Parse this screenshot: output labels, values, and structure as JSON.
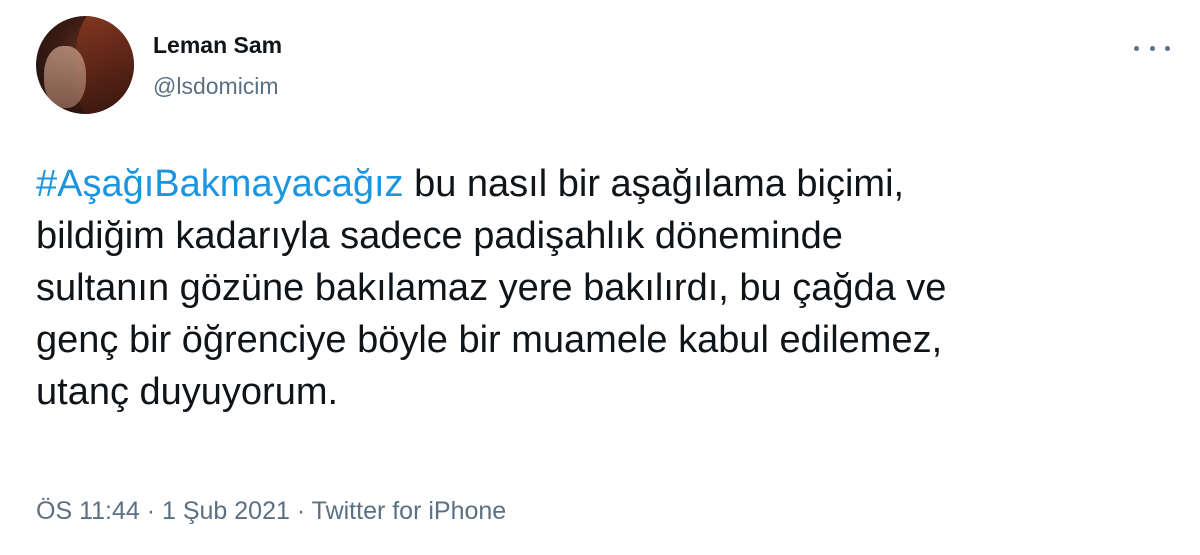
{
  "tweet": {
    "author_name": "Leman Sam",
    "author_handle": "@lsdomicim",
    "hashtag": "#AşağıBakmayacağız",
    "lines": [
      " bu nasıl bir aşağılama biçimi,",
      "bildiğim kadarıyla sadece padişahlık döneminde",
      "sultanın gözüne bakılamaz yere bakılırdı, bu çağda ve",
      "genç bir öğrenciye böyle bir muamele kabul edilemez,",
      "utanç duyuyorum."
    ],
    "time": "ÖS 11:44",
    "date": "1 Şub 2021",
    "source": "Twitter for iPhone",
    "separator": " · "
  },
  "icons": {
    "more": "more-options-icon",
    "avatar": "avatar"
  },
  "colors": {
    "hashtag": "#1b95e0",
    "text": "#0f1419",
    "secondary": "#5b7083"
  }
}
